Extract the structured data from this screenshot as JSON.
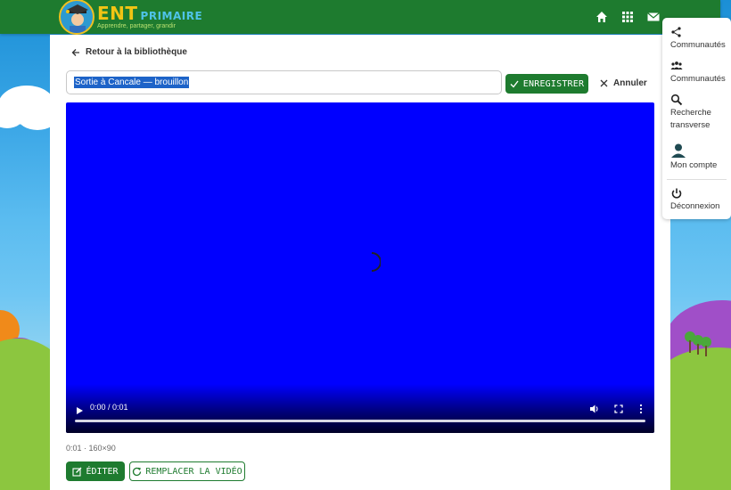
{
  "header": {
    "logo_main": "ENT",
    "logo_sub": "PRIMAIRE",
    "logo_tagline": "Apprendre, partager, grandir",
    "icons": [
      "home-icon",
      "apps-grid-icon",
      "mail-icon"
    ]
  },
  "editor": {
    "back_label": "Retour à la bibliothèque",
    "title_value": "Sortie à Cancale — brouillon",
    "save_label": "ENREGISTRER",
    "cancel_label": "Annuler"
  },
  "video": {
    "background_color": "#0000ff",
    "time_display": "0:00 / 0:01",
    "progress": 0,
    "meta": "0:01 · 160×90"
  },
  "actions": {
    "edit_label": "ÉDITER",
    "replace_label": "REMPLACER LA VIDÉO"
  },
  "side_menu": {
    "items": [
      {
        "label": "Communautés",
        "icon": "share-icon"
      },
      {
        "label": "Communautés",
        "icon": "groups-icon"
      },
      {
        "label": "Recherche transverse",
        "icon": "search-icon"
      },
      {
        "label": "Mon compte",
        "icon": "account-icon"
      },
      {
        "label": "Déconnexion",
        "icon": "power-icon"
      }
    ]
  },
  "colors": {
    "brand_green": "#1e7b2f",
    "selection_blue": "#1d63c8",
    "logo_yellow": "#f2c414"
  }
}
